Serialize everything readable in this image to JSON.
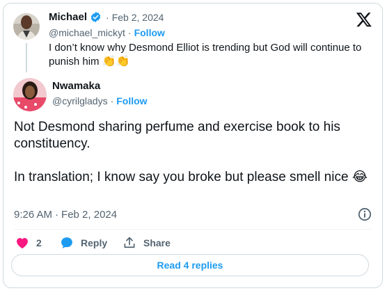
{
  "quoted_tweet": {
    "author_name": "Michael",
    "verified": true,
    "separator": "·",
    "date": "Feb 2, 2024",
    "handle": "@michael_mickyt",
    "follow_label": "Follow",
    "text": "I don’t know why Desmond Elliot is trending but God will continue to punish him",
    "text_emojis": "👏👏"
  },
  "main_tweet": {
    "author_name": "Nwamaka",
    "handle": "@cyrilgladys",
    "follow_label": "Follow",
    "line_1": "Not Desmond sharing perfume and exercise book to his constituency.",
    "line_2": "In translation; I know say you broke but please smell nice",
    "line_2_emoji": "😂",
    "time": "9:26 AM",
    "separator": "·",
    "date": "Feb 2, 2024"
  },
  "actions": {
    "like_count": "2",
    "reply_label": "Reply",
    "share_label": "Share"
  },
  "read_replies_label": "Read 4 replies",
  "colors": {
    "accent": "#1d9bf0",
    "like": "#f91880",
    "muted": "#536471",
    "border": "#cfd9de"
  },
  "icons": {
    "verified": "verified-badge-icon",
    "platform": "x-logo-icon",
    "info": "info-icon",
    "like": "heart-icon",
    "reply": "speech-bubble-icon",
    "share": "share-icon"
  }
}
